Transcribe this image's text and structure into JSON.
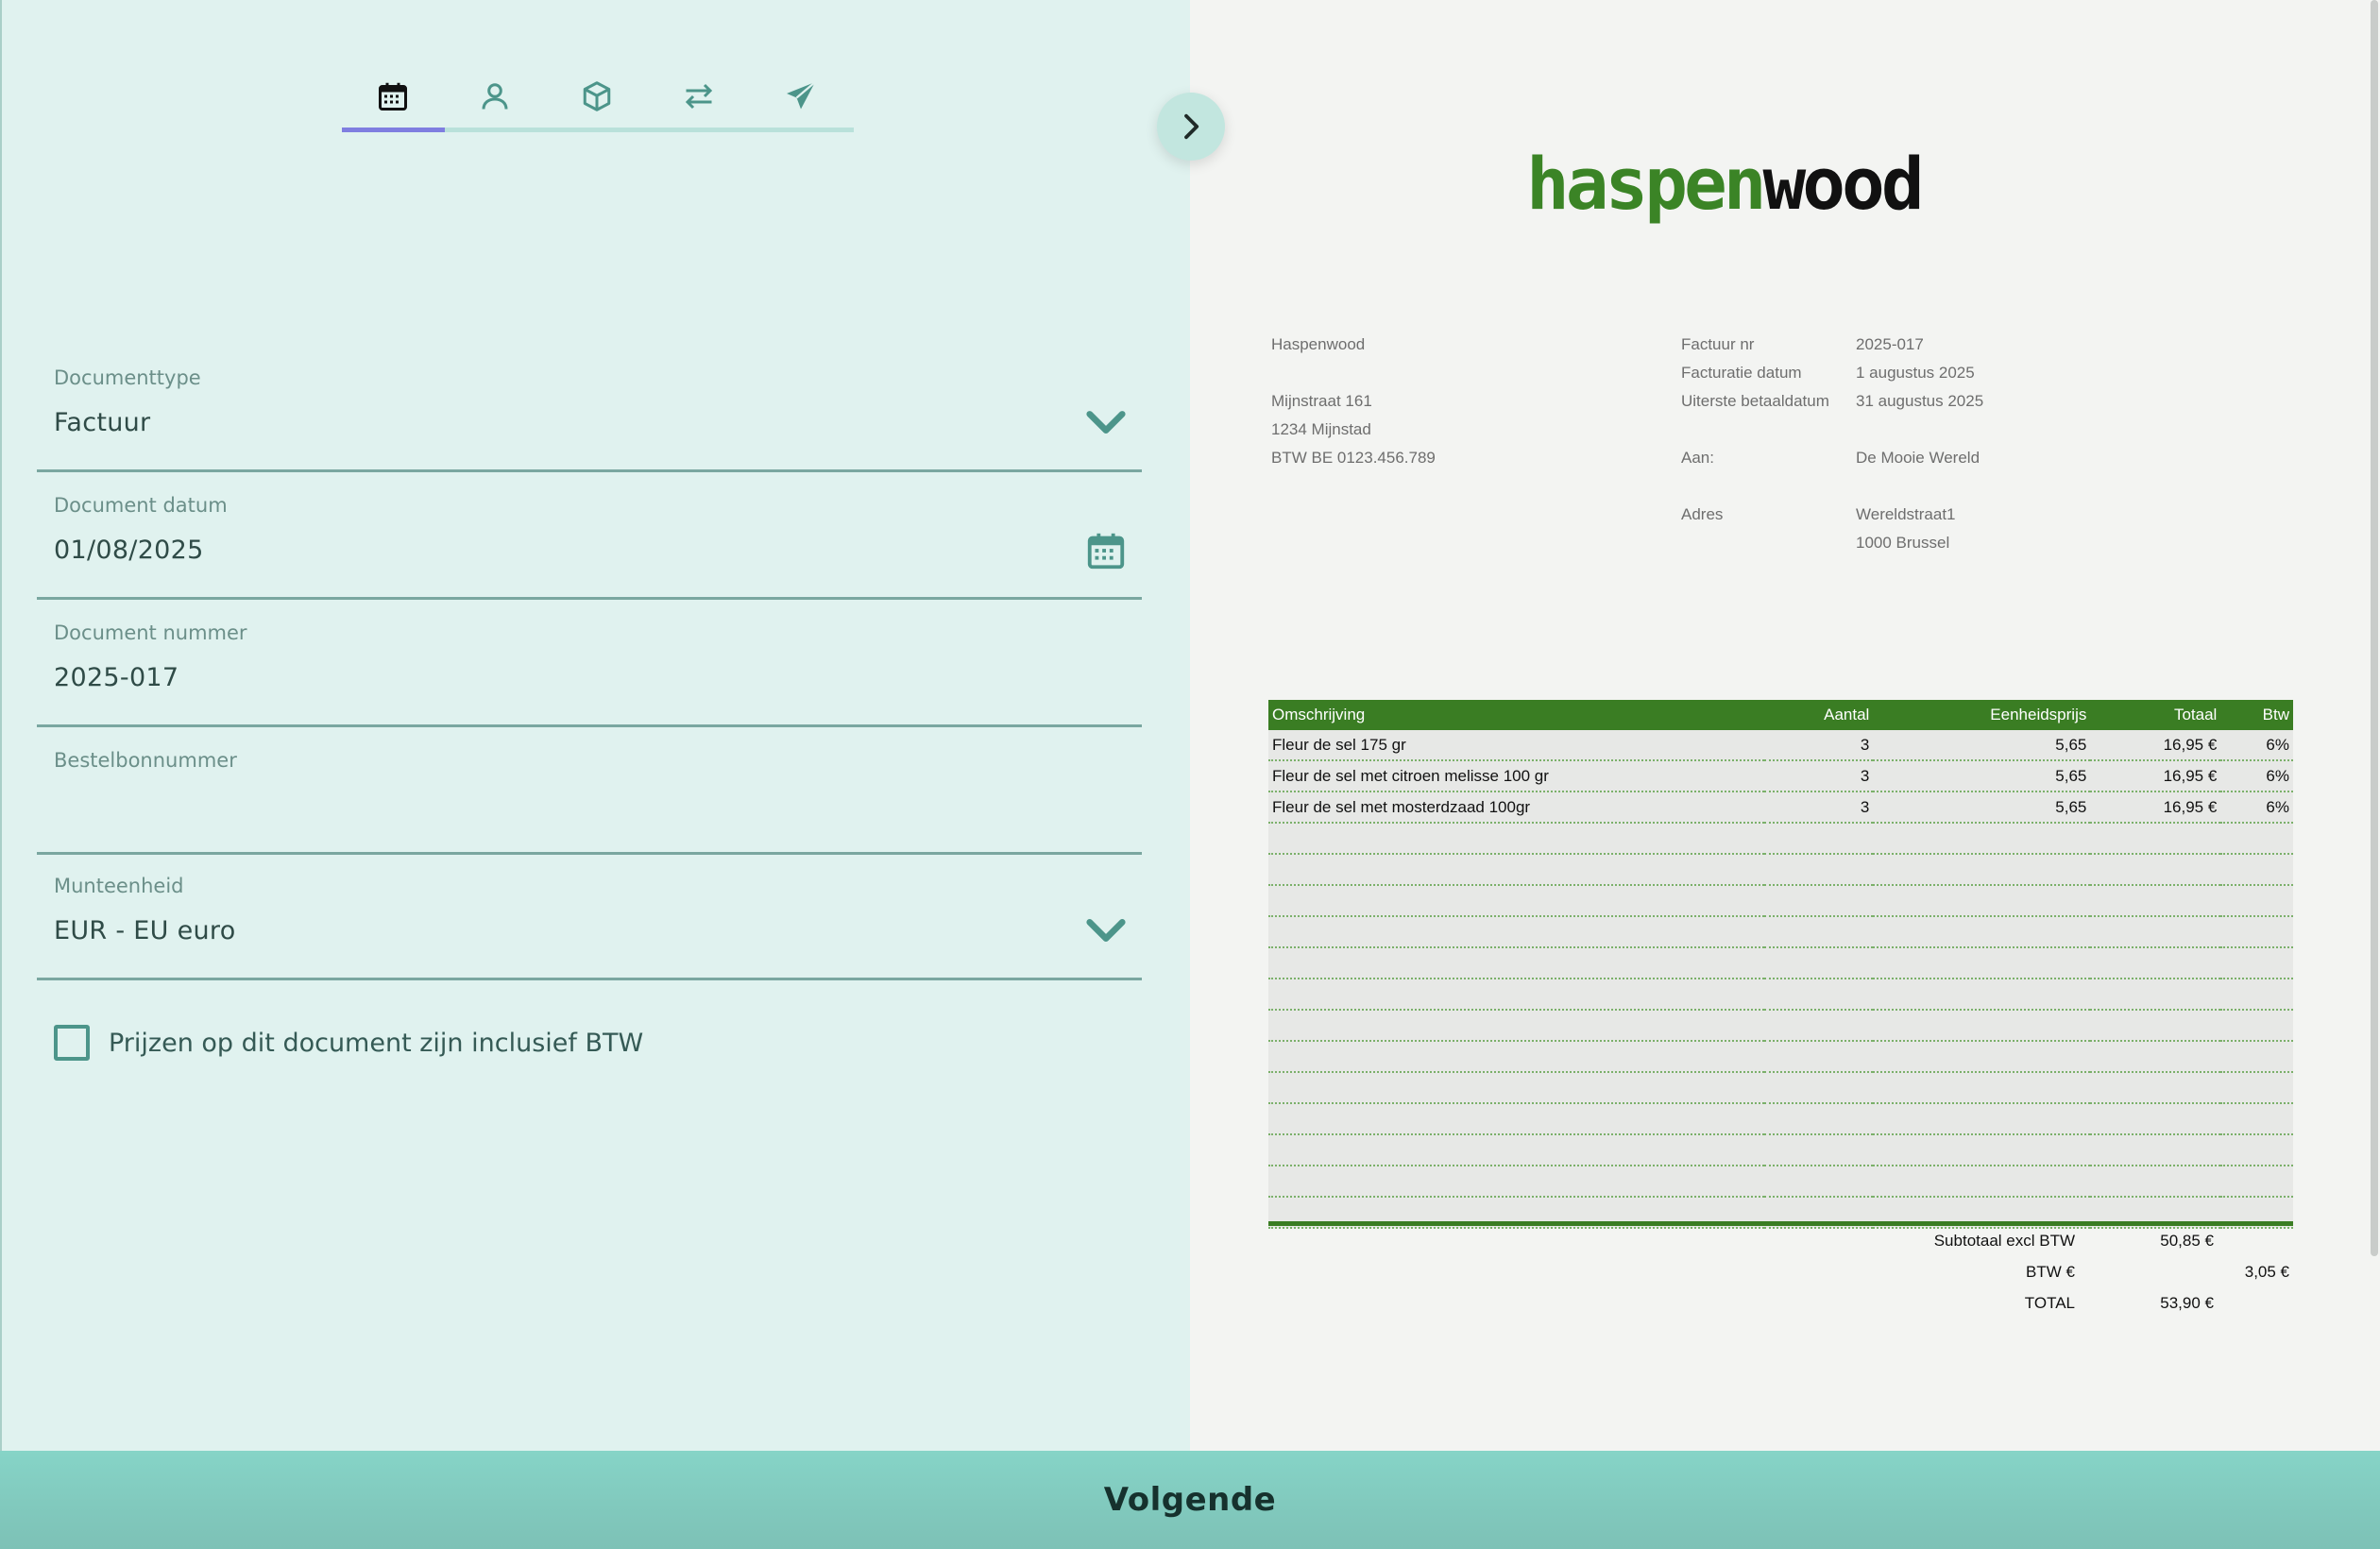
{
  "tabs": [
    {
      "icon": "calendar-icon",
      "active": true
    },
    {
      "icon": "user-icon",
      "active": false
    },
    {
      "icon": "box-icon",
      "active": false
    },
    {
      "icon": "arrows-exchange-icon",
      "active": false
    },
    {
      "icon": "send-icon",
      "active": false
    }
  ],
  "form": {
    "documenttype": {
      "label": "Documenttype",
      "value": "Factuur"
    },
    "datum": {
      "label": "Document datum",
      "value": "01/08/2025"
    },
    "nummer": {
      "label": "Document nummer",
      "value": "2025-017"
    },
    "bestelbon": {
      "label": "Bestelbonnummer",
      "value": ""
    },
    "munteenheid": {
      "label": "Munteenheid",
      "value": "EUR - EU euro"
    },
    "btw_inclusief": {
      "label": "Prijzen op dit document zijn inclusief BTW",
      "checked": false
    }
  },
  "next_button": "Volgende",
  "invoice": {
    "logo_part1": "haspen",
    "logo_part2": "wood",
    "company": {
      "name": "Haspenwood",
      "street": "Mijnstraat 161",
      "city": "1234 Mijnstad",
      "vat": "BTW BE 0123.456.789"
    },
    "meta": {
      "factuur_nr_label": "Factuur nr",
      "factuur_nr": "2025-017",
      "datum_label": "Facturatie datum",
      "datum": "1 augustus 2025",
      "uiterste_label": "Uiterste betaaldatum",
      "uiterste": "31 augustus 2025",
      "aan_label": "Aan:",
      "aan": "De Mooie Wereld",
      "adres_label": "Adres",
      "adres1": "Wereldstraat1",
      "adres2": "1000 Brussel"
    },
    "columns": [
      "Omschrijving",
      "Aantal",
      "Eenheidsprijs",
      "Totaal",
      "Btw"
    ],
    "rows": [
      [
        "Fleur de sel 175 gr",
        "3",
        "5,65",
        "16,95 €",
        "6%"
      ],
      [
        "Fleur de sel met citroen melisse 100 gr",
        "3",
        "5,65",
        "16,95 €",
        "6%"
      ],
      [
        "Fleur de sel met mosterdzaad 100gr",
        "3",
        "5,65",
        "16,95 €",
        "6%"
      ]
    ],
    "empty_rows": 13,
    "totals": {
      "subtotaal_label": "Subtotaal excl BTW",
      "subtotaal": "50,85 €",
      "btw_label": "BTW €",
      "btw": "3,05 €",
      "total_label": "TOTAL",
      "total": "53,90 €"
    }
  },
  "colors": {
    "accent_green": "#3a7d23",
    "panel": "#e0f2ef",
    "tab_active": "#7f7ee0",
    "button": "#86d4c7"
  }
}
